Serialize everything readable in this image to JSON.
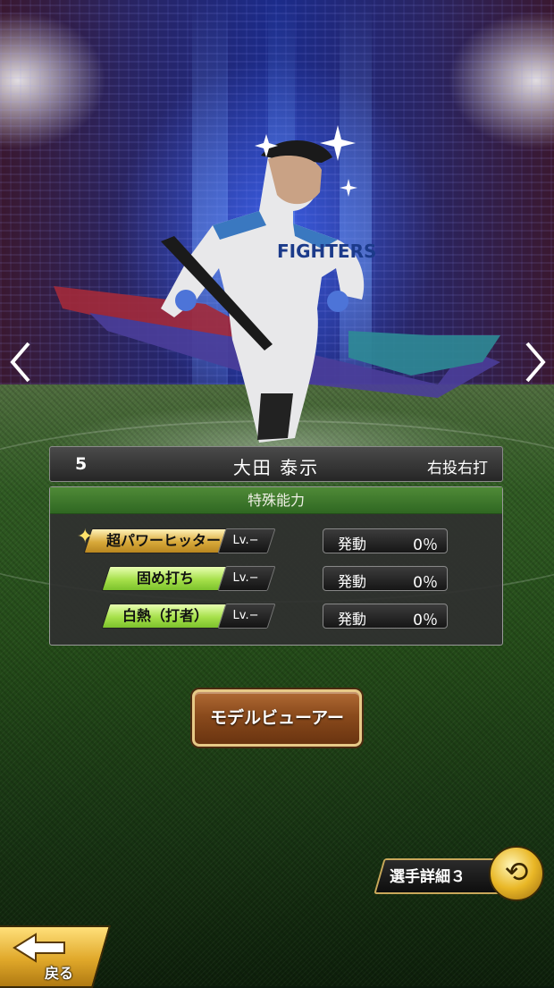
{
  "player": {
    "number": "5",
    "name": "大田 泰示",
    "handedness": "右投右打",
    "team_jersey": "FIGHTERS"
  },
  "abilities": {
    "header": "特殊能力",
    "items": [
      {
        "prefix": "超",
        "name": "超パワーヒッター",
        "lv": "Lv.−",
        "style": "gold",
        "activation_label": "発動",
        "activation_value": "0％"
      },
      {
        "prefix": "",
        "name": "固め打ち",
        "lv": "Lv.−",
        "style": "green",
        "activation_label": "発動",
        "activation_value": "0％"
      },
      {
        "prefix": "",
        "name": "白熱（打者）",
        "lv": "Lv.−",
        "style": "green",
        "activation_label": "発動",
        "activation_value": "0％"
      }
    ]
  },
  "buttons": {
    "model_viewer": "モデルビューアー",
    "player_detail": "選手詳細３",
    "back": "戻る"
  },
  "icons": {
    "prev": "chevron-left-icon",
    "next": "chevron-right-icon",
    "swap": "swap-arrows-icon",
    "back": "back-arrow-icon"
  },
  "colors": {
    "ability_header": "#3f7a2c",
    "gold_tag": "#d8a93a",
    "green_tag": "#a6e04a",
    "model_button": "#8a4a1c",
    "back_button": "#e0a82a"
  }
}
